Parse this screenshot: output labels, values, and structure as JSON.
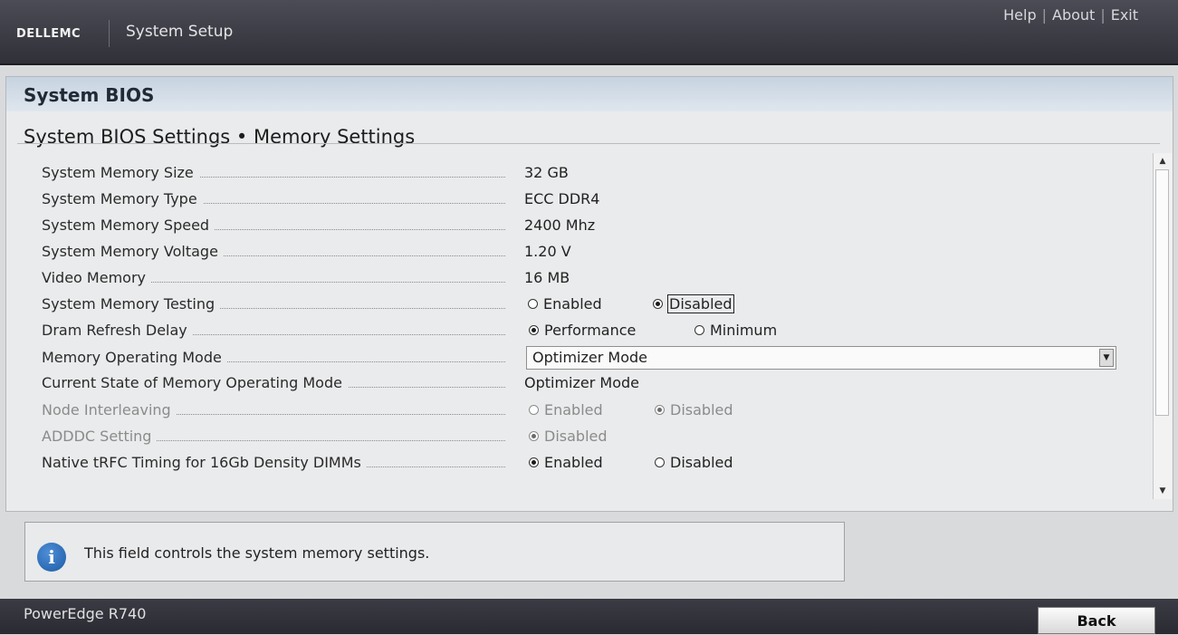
{
  "header": {
    "brand": "DELLEMC",
    "app_title": "System Setup",
    "links": {
      "help": "Help",
      "about": "About",
      "exit": "Exit",
      "separator": "|"
    }
  },
  "panel": {
    "title": "System BIOS",
    "breadcrumb": "System BIOS Settings • Memory Settings"
  },
  "settings": {
    "memory_size": {
      "label": "System Memory Size",
      "value": "32 GB"
    },
    "memory_type": {
      "label": "System Memory Type",
      "value": "ECC DDR4"
    },
    "memory_speed": {
      "label": "System Memory Speed",
      "value": "2400 Mhz"
    },
    "memory_voltage": {
      "label": "System Memory Voltage",
      "value": "1.20 V"
    },
    "video_memory": {
      "label": "Video Memory",
      "value": "16 MB"
    },
    "memory_testing": {
      "label": "System Memory Testing",
      "opt1": "Enabled",
      "opt2": "Disabled",
      "selected": "Disabled"
    },
    "dram_refresh": {
      "label": "Dram Refresh Delay",
      "opt1": "Performance",
      "opt2": "Minimum",
      "selected": "Performance"
    },
    "operating_mode": {
      "label": "Memory Operating Mode",
      "value": "Optimizer Mode"
    },
    "current_mode": {
      "label": "Current State of Memory Operating Mode",
      "value": "Optimizer Mode"
    },
    "node_interleaving": {
      "label": "Node Interleaving",
      "opt1": "Enabled",
      "opt2": "Disabled",
      "selected": "Disabled"
    },
    "adddc": {
      "label": "ADDDC Setting",
      "opt1": "Disabled",
      "selected": "Disabled"
    },
    "native_trfc": {
      "label": "Native tRFC Timing for 16Gb Density DIMMs",
      "opt1": "Enabled",
      "opt2": "Disabled",
      "selected": "Enabled"
    }
  },
  "help_box": {
    "text": "This field controls the system memory settings.",
    "icon": "info-icon"
  },
  "footer": {
    "model": "PowerEdge R740",
    "back_label": "Back"
  }
}
